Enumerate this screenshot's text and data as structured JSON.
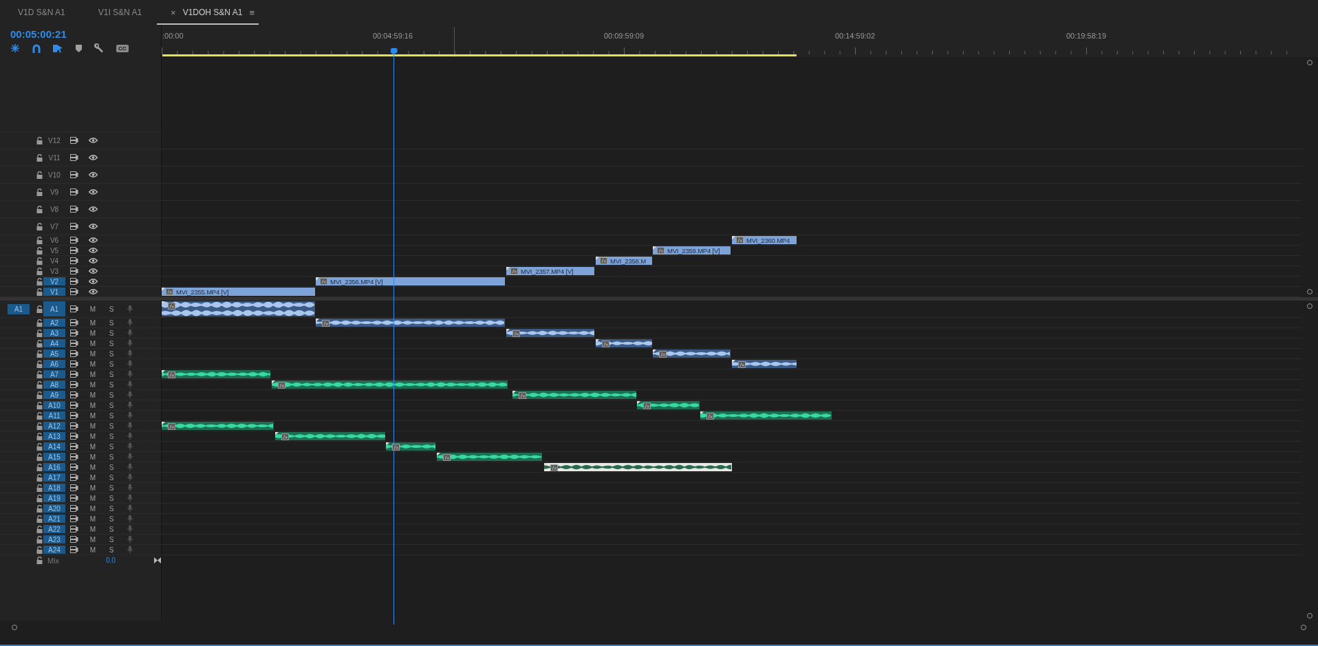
{
  "tabs": [
    {
      "label": "V1D S&N A1",
      "selected": false
    },
    {
      "label": "V1I  S&N A1",
      "selected": false
    },
    {
      "label": "V1DOH S&N A1",
      "selected": true,
      "close": "×",
      "menu": "≡"
    }
  ],
  "timecode": "00:05:00:21",
  "toolbar": [
    {
      "kind": "nest",
      "on": true
    },
    {
      "kind": "snap",
      "on": true
    },
    {
      "kind": "linked",
      "on": true
    },
    {
      "kind": "marker",
      "on": false
    },
    {
      "kind": "settings",
      "on": false
    },
    {
      "kind": "captions",
      "on": false,
      "label": "CC"
    }
  ],
  "ruler": {
    "labels": [
      ":00:00",
      "00:04:59:16",
      "00:09:59:09",
      "00:14:59:02",
      "00:19:58:19"
    ]
  },
  "video_tracks": [
    {
      "label": "V12",
      "selected": false
    },
    {
      "label": "V11",
      "selected": false
    },
    {
      "label": "V10",
      "selected": false
    },
    {
      "label": "V9",
      "selected": false
    },
    {
      "label": "V8",
      "selected": false
    },
    {
      "label": "V7",
      "selected": false
    },
    {
      "label": "V6",
      "selected": false,
      "clips": [
        {
          "name": "MVI_2360.MP4",
          "selected": false
        }
      ]
    },
    {
      "label": "V5",
      "selected": false,
      "clips": [
        {
          "name": "MVI_2359.MP4 [V]",
          "selected": false
        }
      ]
    },
    {
      "label": "V4",
      "selected": false,
      "clips": [
        {
          "name": "MVI_2358.M",
          "selected": false
        }
      ]
    },
    {
      "label": "V3",
      "selected": false,
      "clips": [
        {
          "name": "MVI_2357.MP4 [V]",
          "selected": false
        }
      ]
    },
    {
      "label": "V2",
      "selected": true,
      "clips": [
        {
          "name": "MVI_2356.MP4 [V]",
          "selected": false
        }
      ]
    },
    {
      "label": "V1",
      "selected": true,
      "clips": [
        {
          "name": "MVI_2355.MP4 [V]",
          "selected": false
        }
      ]
    }
  ],
  "audio_tracks": [
    {
      "label": "A1",
      "selected": true,
      "source": "A1",
      "mute": "M",
      "solo": "S",
      "clips": [
        {
          "kind": "linked-audio",
          "selected": false
        }
      ]
    },
    {
      "label": "A2",
      "selected": true,
      "mute": "M",
      "solo": "S",
      "clips": [
        {
          "kind": "linked-audio",
          "selected": false
        }
      ]
    },
    {
      "label": "A3",
      "selected": true,
      "mute": "M",
      "solo": "S",
      "clips": [
        {
          "kind": "linked-audio",
          "selected": false
        }
      ]
    },
    {
      "label": "A4",
      "selected": true,
      "mute": "M",
      "solo": "S",
      "clips": [
        {
          "kind": "linked-audio",
          "selected": false
        }
      ]
    },
    {
      "label": "A5",
      "selected": true,
      "mute": "M",
      "solo": "S",
      "clips": [
        {
          "kind": "linked-audio",
          "selected": false
        }
      ]
    },
    {
      "label": "A6",
      "selected": true,
      "mute": "M",
      "solo": "S",
      "clips": [
        {
          "kind": "linked-audio",
          "selected": false
        }
      ]
    },
    {
      "label": "A7",
      "selected": true,
      "mute": "M",
      "solo": "S",
      "clips": [
        {
          "kind": "audio",
          "selected": false
        }
      ]
    },
    {
      "label": "A8",
      "selected": true,
      "mute": "M",
      "solo": "S",
      "clips": [
        {
          "kind": "audio",
          "selected": false
        }
      ]
    },
    {
      "label": "A9",
      "selected": true,
      "mute": "M",
      "solo": "S",
      "clips": [
        {
          "kind": "audio",
          "selected": false
        }
      ]
    },
    {
      "label": "A10",
      "selected": true,
      "mute": "M",
      "solo": "S",
      "clips": [
        {
          "kind": "audio",
          "selected": false
        }
      ]
    },
    {
      "label": "A11",
      "selected": true,
      "mute": "M",
      "solo": "S",
      "clips": [
        {
          "kind": "audio",
          "selected": false
        }
      ]
    },
    {
      "label": "A12",
      "selected": true,
      "mute": "M",
      "solo": "S",
      "clips": [
        {
          "kind": "audio",
          "selected": false
        }
      ]
    },
    {
      "label": "A13",
      "selected": true,
      "mute": "M",
      "solo": "S",
      "clips": [
        {
          "kind": "audio",
          "selected": false
        }
      ]
    },
    {
      "label": "A14",
      "selected": true,
      "mute": "M",
      "solo": "S",
      "clips": [
        {
          "kind": "audio",
          "selected": false
        }
      ]
    },
    {
      "label": "A15",
      "selected": true,
      "mute": "M",
      "solo": "S",
      "clips": [
        {
          "kind": "audio",
          "selected": false
        }
      ]
    },
    {
      "label": "A16",
      "selected": true,
      "mute": "M",
      "solo": "S",
      "clips": [
        {
          "kind": "audio",
          "selected": true
        }
      ]
    },
    {
      "label": "A17",
      "selected": true,
      "mute": "M",
      "solo": "S"
    },
    {
      "label": "A18",
      "selected": true,
      "mute": "M",
      "solo": "S"
    },
    {
      "label": "A19",
      "selected": true,
      "mute": "M",
      "solo": "S"
    },
    {
      "label": "A20",
      "selected": true,
      "mute": "M",
      "solo": "S"
    },
    {
      "label": "A21",
      "selected": true,
      "mute": "M",
      "solo": "S"
    },
    {
      "label": "A22",
      "selected": true,
      "mute": "M",
      "solo": "S"
    },
    {
      "label": "A23",
      "selected": true,
      "mute": "M",
      "solo": "S"
    },
    {
      "label": "A24",
      "selected": true,
      "mute": "M",
      "solo": "S"
    }
  ],
  "mix": {
    "label": "Mix",
    "value": "0.0"
  }
}
